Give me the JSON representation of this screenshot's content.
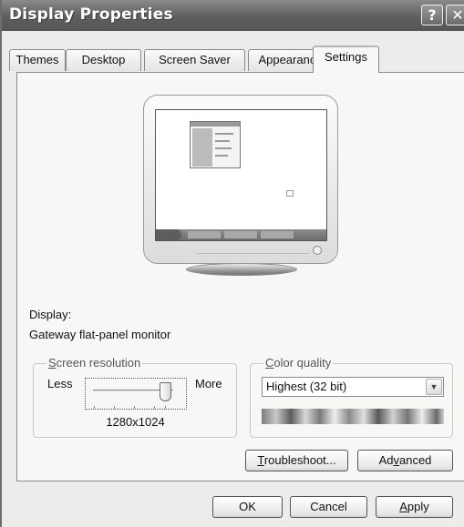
{
  "window": {
    "title": "Display Properties",
    "help_glyph": "?",
    "close_glyph": "✕"
  },
  "tabs": [
    {
      "label": "Themes"
    },
    {
      "label": "Desktop"
    },
    {
      "label": "Screen Saver"
    },
    {
      "label": "Appearance"
    },
    {
      "label": "Settings"
    }
  ],
  "active_tab": "Settings",
  "display": {
    "label": "Display:",
    "value": "Gateway flat-panel monitor"
  },
  "screen_resolution": {
    "legend_accel": "S",
    "legend_rest": "creen resolution",
    "less_label": "Less",
    "more_label": "More",
    "value": "1280x1024",
    "slider_level": 1.0
  },
  "color_quality": {
    "legend_accel": "C",
    "legend_rest": "olor quality",
    "selected": "Highest (32 bit)"
  },
  "buttons": {
    "troubleshoot_accel": "T",
    "troubleshoot_rest": "roubleshoot...",
    "advanced_pre": "Ad",
    "advanced_accel": "v",
    "advanced_rest": "anced",
    "ok": "OK",
    "cancel": "Cancel",
    "apply_accel": "A",
    "apply_rest": "pply"
  }
}
